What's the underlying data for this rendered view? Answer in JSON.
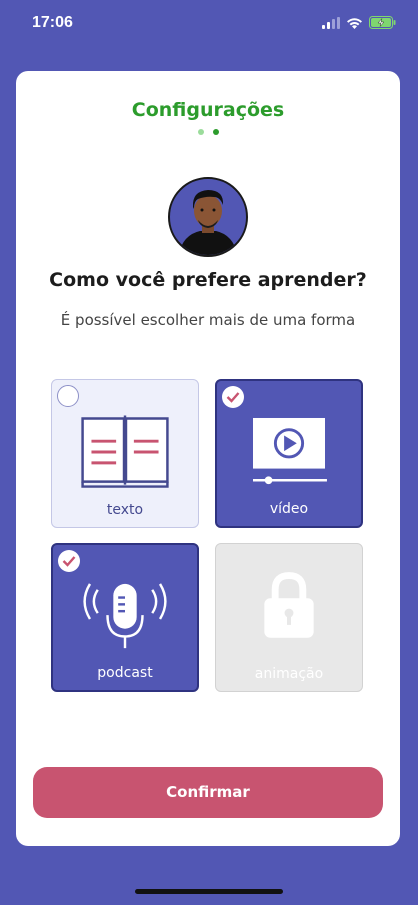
{
  "status_bar": {
    "time": "17:06"
  },
  "header": {
    "title": "Configurações"
  },
  "content": {
    "question": "Como você prefere aprender?",
    "subtitle": "É possível escolher mais de uma forma"
  },
  "options": [
    {
      "label": "texto",
      "icon": "book-icon",
      "selected": false,
      "locked": false
    },
    {
      "label": "vídeo",
      "icon": "video-player-icon",
      "selected": true,
      "locked": false
    },
    {
      "label": "podcast",
      "icon": "microphone-icon",
      "selected": true,
      "locked": false
    },
    {
      "label": "animação",
      "icon": "lock-icon",
      "selected": false,
      "locked": true
    }
  ],
  "actions": {
    "confirm_label": "Confirmar"
  },
  "colors": {
    "background": "#5257b4",
    "accent_green": "#2c9c2c",
    "selected_tile": "#5257b4",
    "confirm_button": "#c85470",
    "check_mark": "#c85470"
  }
}
